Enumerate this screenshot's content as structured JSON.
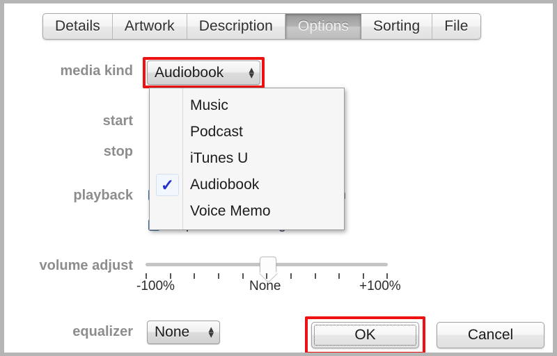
{
  "window": {
    "frame_color": "#b5b5b5",
    "background": "#ffffff"
  },
  "tabs": [
    {
      "label": "Details",
      "selected": false
    },
    {
      "label": "Artwork",
      "selected": false
    },
    {
      "label": "Description",
      "selected": false
    },
    {
      "label": "Options",
      "selected": true
    },
    {
      "label": "Sorting",
      "selected": false
    },
    {
      "label": "File",
      "selected": false
    }
  ],
  "fields": {
    "media_kind": {
      "label": "media kind",
      "value": "Audiobook",
      "highlight_color": "#ee1111"
    },
    "start": {
      "label": "start"
    },
    "stop": {
      "label": "stop"
    },
    "playback": {
      "label": "playback"
    },
    "equalizer": {
      "label": "equalizer",
      "value": "None"
    }
  },
  "media_kind_menu": {
    "options": [
      {
        "label": "Music",
        "checked": false
      },
      {
        "label": "Podcast",
        "checked": false
      },
      {
        "label": "iTunes U",
        "checked": false
      },
      {
        "label": "Audiobook",
        "checked": true
      },
      {
        "label": "Voice Memo",
        "checked": false
      }
    ],
    "check_glyph": "✓"
  },
  "checkboxes": [
    {
      "label": "Remember playback position",
      "checked": true,
      "visible_fragment": "tion"
    },
    {
      "label": "Skip when shuffling",
      "checked": true
    }
  ],
  "volume": {
    "label": "volume adjust",
    "min_label": "-100%",
    "center_label": "None",
    "max_label": "+100%",
    "value": 0,
    "range": [
      -100,
      100
    ],
    "tick_count": 11
  },
  "buttons": {
    "ok": {
      "label": "OK",
      "focused": true,
      "highlight_color": "#ee1111"
    },
    "cancel": {
      "label": "Cancel",
      "focused": false
    }
  },
  "icons": {
    "stepper_up": "▴",
    "stepper_down": "▾"
  }
}
